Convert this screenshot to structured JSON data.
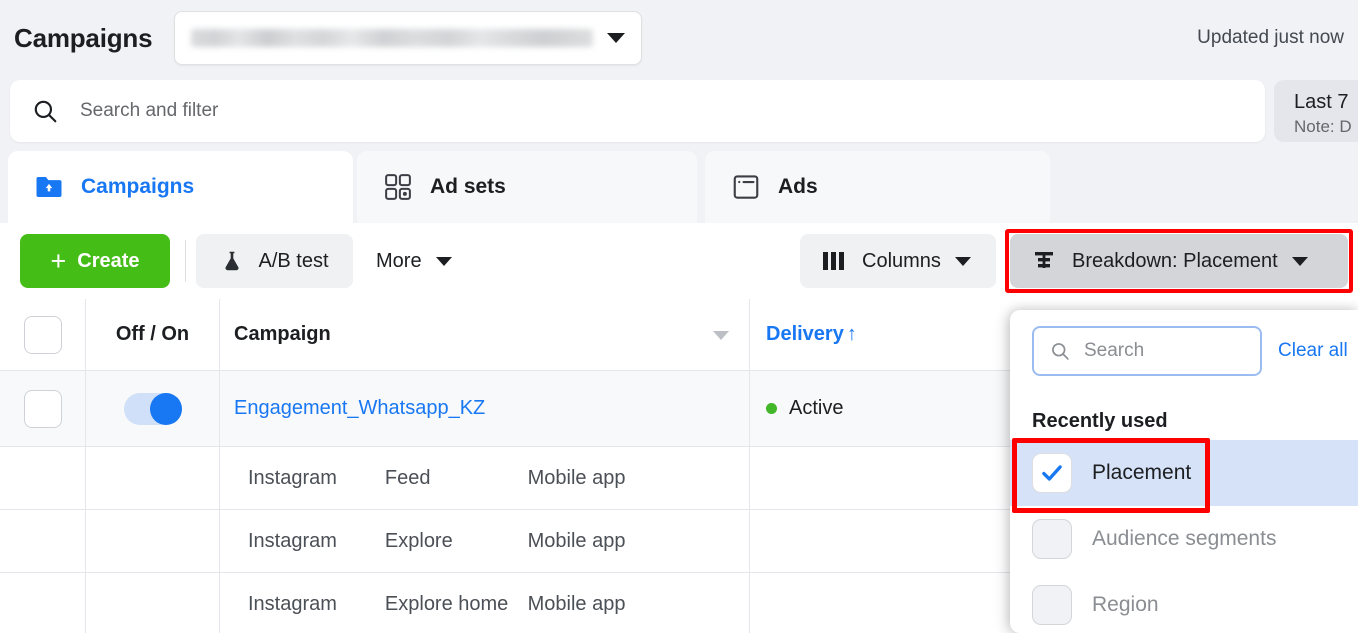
{
  "header": {
    "title": "Campaigns",
    "account_selector": {
      "value": "",
      "redacted": true,
      "caret_icon": "chevron-down-icon"
    },
    "updated_status": "Updated just now"
  },
  "search": {
    "placeholder": "Search and filter",
    "icon": "search-icon"
  },
  "date_range": {
    "main": "Last 7",
    "note": "Note: D"
  },
  "tabs": [
    {
      "label": "Campaigns",
      "icon": "folder-icon",
      "active": true
    },
    {
      "label": "Ad sets",
      "icon": "grid-four-squares-icon",
      "active": false
    },
    {
      "label": "Ads",
      "icon": "window-card-icon",
      "active": false
    }
  ],
  "toolbar": {
    "create_label": "Create",
    "create_plus": "+",
    "ab_test_label": "A/B test",
    "ab_test_icon": "flask-icon",
    "more_label": "More",
    "columns_label": "Columns",
    "columns_icon": "columns-icon",
    "breakdown_label": "Breakdown: Placement",
    "breakdown_icon": "breakdown-lines-icon",
    "breakdown_highlighted": true,
    "highlight_color": "#ff0000",
    "create_color": "#45bd17"
  },
  "table": {
    "headers": {
      "select_all": "",
      "off_on": "Off / On",
      "campaign": "Campaign",
      "delivery": "Delivery",
      "delivery_sort": "↑"
    },
    "campaign_row": {
      "toggle_on": true,
      "name": "Engagement_Whatsapp_KZ",
      "status": "Active",
      "status_color": "#42b72a"
    },
    "breakdown_rows": [
      {
        "platform": "Instagram",
        "placement": "Feed",
        "device": "Mobile app"
      },
      {
        "platform": "Instagram",
        "placement": "Explore",
        "device": "Mobile app"
      },
      {
        "platform": "Instagram",
        "placement": "Explore home",
        "device": "Mobile app"
      }
    ]
  },
  "breakdown_panel": {
    "search_placeholder": "Search",
    "search_icon": "search-icon",
    "clear_all_label": "Clear all",
    "section_heading": "Recently used",
    "options": [
      {
        "label": "Placement",
        "checked": true,
        "disabled": false,
        "highlighted": true
      },
      {
        "label": "Audience segments",
        "checked": false,
        "disabled": true,
        "highlighted": false
      },
      {
        "label": "Region",
        "checked": false,
        "disabled": true,
        "highlighted": false
      }
    ],
    "accent_color": "#1877f2",
    "selected_row_color": "#d6e2f7"
  }
}
